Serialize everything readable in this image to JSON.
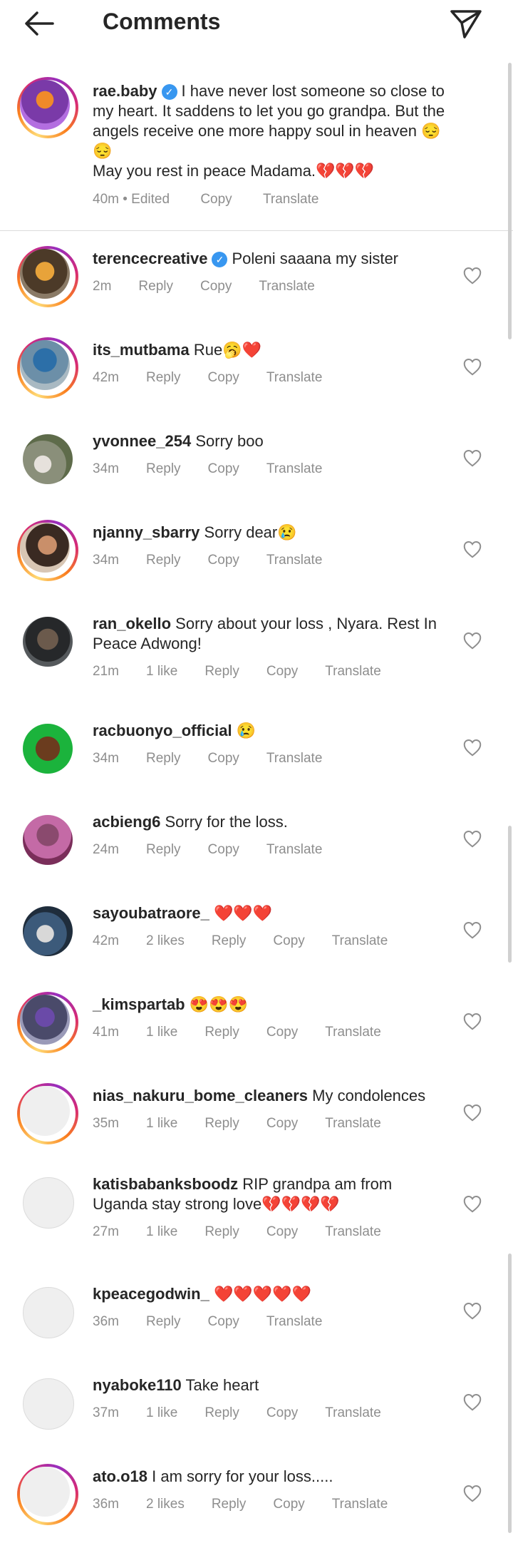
{
  "header": {
    "title": "Comments"
  },
  "caption": {
    "username": "rae.baby",
    "text": "I have never lost someone so close to my heart. It saddens to let you go grandpa.  But the angels receive one more happy soul in heaven 😔😔",
    "text2": "May you rest in peace Madama.💔💔💔",
    "time": "40m • Edited",
    "copy": "Copy",
    "translate": "Translate"
  },
  "actions": {
    "reply": "Reply",
    "copy": "Copy",
    "translate": "Translate"
  },
  "comments": [
    {
      "username": "terencecreative",
      "verified": true,
      "text": "Poleni saaana my sister",
      "time": "2m",
      "likes": ""
    },
    {
      "username": "its_mutbama",
      "text": "Rue🥱❤️",
      "time": "42m",
      "likes": ""
    },
    {
      "username": "yvonnee_254",
      "text": "Sorry boo",
      "time": "34m",
      "likes": ""
    },
    {
      "username": "njanny_sbarry",
      "text": "Sorry dear😢",
      "time": "34m",
      "likes": ""
    },
    {
      "username": "ran_okello",
      "text": "Sorry about your loss ,  Nyara. Rest In Peace Adwong!",
      "time": "21m",
      "likes": "1 like"
    },
    {
      "username": "racbuonyo_official",
      "text": "😢",
      "time": "34m",
      "likes": ""
    },
    {
      "username": "acbieng6",
      "text": "Sorry for the loss.",
      "time": "24m",
      "likes": ""
    },
    {
      "username": "sayoubatraore_",
      "text": "❤️❤️❤️",
      "time": "42m",
      "likes": "2 likes"
    },
    {
      "username": "_kimspartab",
      "text": "😍😍😍",
      "time": "41m",
      "likes": "1 like"
    },
    {
      "username": "nias_nakuru_bome_cleaners",
      "text": "My condolences",
      "time": "35m",
      "likes": "1 like"
    },
    {
      "username": "katisbabanksboodz",
      "text": "RIP grandpa  am from Uganda stay strong  love💔💔💔💔",
      "time": "27m",
      "likes": "1 like"
    },
    {
      "username": "kpeacegodwin_",
      "text": "❤️❤️❤️❤️❤️",
      "time": "36m",
      "likes": ""
    },
    {
      "username": "nyaboke110",
      "text": "Take heart",
      "time": "37m",
      "likes": "1 like"
    },
    {
      "username": "ato.o18",
      "text": "I am sorry for your loss.....",
      "time": "36m",
      "likes": "2 likes"
    }
  ]
}
